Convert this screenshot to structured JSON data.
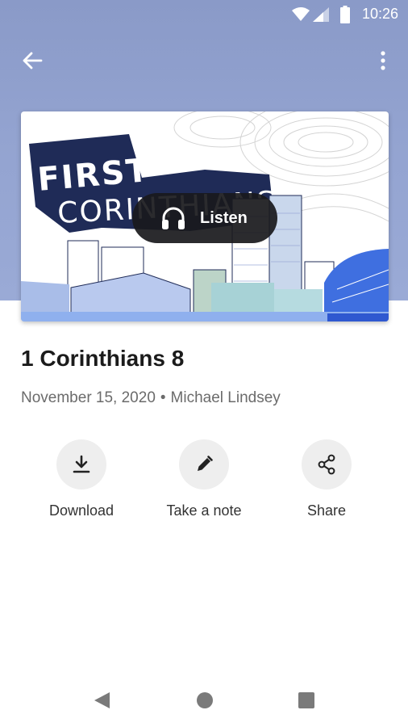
{
  "status_bar": {
    "time": "10:26"
  },
  "toolbar": {
    "back_icon": "arrow-left-icon",
    "more_icon": "more-vertical-icon"
  },
  "artwork": {
    "line1": "FIRST",
    "line2": "CORINTHIANS"
  },
  "listen": {
    "icon": "headphones-icon",
    "label": "Listen"
  },
  "sermon": {
    "title": "1 Corinthians 8",
    "date": "November 15, 2020",
    "separator": "•",
    "speaker": "Michael Lindsey"
  },
  "actions": [
    {
      "icon": "download-icon",
      "label": "Download"
    },
    {
      "icon": "pencil-icon",
      "label": "Take a note"
    },
    {
      "icon": "share-icon",
      "label": "Share"
    }
  ],
  "colors": {
    "header_background": "#93a3d0",
    "listen_button": "#19191c",
    "title_text": "#1b1b1b",
    "meta_text": "#6b6b6b",
    "action_circle": "#eeeeee",
    "artwork_banner": "#1f2b57",
    "artwork_blue": "#3f6fe0"
  },
  "nav_bar": {
    "back_icon": "nav-back-triangle-icon",
    "home_icon": "nav-home-circle-icon",
    "recents_icon": "nav-recents-square-icon"
  }
}
